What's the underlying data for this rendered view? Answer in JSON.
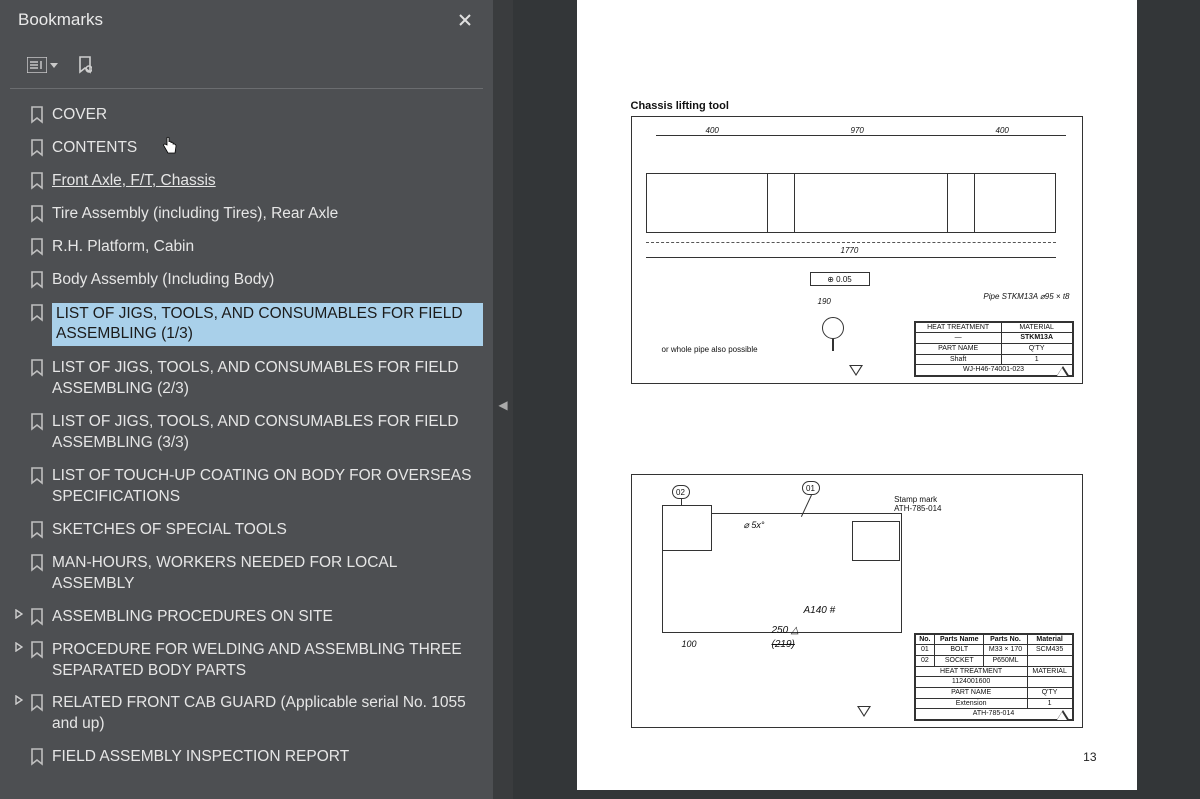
{
  "sidebar": {
    "title": "Bookmarks",
    "items": [
      {
        "label": "COVER",
        "selected": false,
        "expandable": false,
        "underlined": false
      },
      {
        "label": "CONTENTS",
        "selected": false,
        "expandable": false,
        "underlined": false
      },
      {
        "label": "Front Axle, F/T, Chassis",
        "selected": false,
        "expandable": false,
        "underlined": true
      },
      {
        "label": "Tire Assembly (including Tires), Rear Axle",
        "selected": false,
        "expandable": false,
        "underlined": false
      },
      {
        "label": "R.H. Platform, Cabin",
        "selected": false,
        "expandable": false,
        "underlined": false
      },
      {
        "label": "Body Assembly (Including Body)",
        "selected": false,
        "expandable": false,
        "underlined": false
      },
      {
        "label": "LIST OF JIGS, TOOLS, AND CONSUMABLES FOR FIELD ASSEMBLING (1/3)",
        "selected": true,
        "expandable": false,
        "underlined": false
      },
      {
        "label": "LIST OF JIGS, TOOLS, AND CONSUMABLES FOR FIELD ASSEMBLING (2/3)",
        "selected": false,
        "expandable": false,
        "underlined": false
      },
      {
        "label": "LIST OF JIGS, TOOLS, AND CONSUMABLES FOR FIELD ASSEMBLING (3/3)",
        "selected": false,
        "expandable": false,
        "underlined": false
      },
      {
        "label": "LIST OF TOUCH-UP COATING ON BODY FOR OVERSEAS SPECIFICATIONS",
        "selected": false,
        "expandable": false,
        "underlined": false
      },
      {
        "label": "SKETCHES OF SPECIAL TOOLS",
        "selected": false,
        "expandable": false,
        "underlined": false
      },
      {
        "label": "MAN-HOURS, WORKERS NEEDED FOR LOCAL ASSEMBLY",
        "selected": false,
        "expandable": false,
        "underlined": false
      },
      {
        "label": "ASSEMBLING PROCEDURES ON SITE",
        "selected": false,
        "expandable": true,
        "underlined": false
      },
      {
        "label": "PROCEDURE FOR WELDING AND ASSEMBLING THREE SEPARATED BODY PARTS",
        "selected": false,
        "expandable": true,
        "underlined": false
      },
      {
        "label": "RELATED FRONT CAB GUARD (Applicable serial No. 1055 and up)",
        "selected": false,
        "expandable": true,
        "underlined": false
      },
      {
        "label": "FIELD ASSEMBLY INSPECTION REPORT",
        "selected": false,
        "expandable": false,
        "underlined": false
      }
    ]
  },
  "page": {
    "number": "13",
    "drawing1": {
      "title": "Chassis lifting tool",
      "dims_top": [
        "400",
        "970",
        "400"
      ],
      "dim_bottom": "1770",
      "tolerance": "⊕ 0.05",
      "pipe_note": "Pipe  STKM13A  ⌀95 × t8",
      "sub_note": "or whole pipe also possible",
      "small_dim": "190",
      "titleblock": {
        "heat_label": "HEAT TREATMENT",
        "heat_val": "—",
        "mat_label": "MATERIAL",
        "mat_val": "STKM13A",
        "part_label": "PART NAME",
        "part_val": "Shaft",
        "qty_label": "Q'TY",
        "qty_val": "1",
        "dwg_no": "WJ-H46-74001-023"
      }
    },
    "drawing2": {
      "balloons": {
        "b1": "02",
        "b2": "01"
      },
      "stamp_label": "Stamp mark",
      "stamp_val": "ATH-785-014",
      "scribble": "⌀ 5x°",
      "dim100": "100",
      "hand1": "A140 #",
      "hand2": "250 △",
      "hand3": "(219)",
      "parts_header": {
        "no": "No.",
        "name": "Parts Name",
        "pno": "Parts No.",
        "mat": "Material"
      },
      "parts": [
        {
          "no": "01",
          "name": "BOLT",
          "pno": "M33 × 170",
          "mat": "SCM435"
        },
        {
          "no": "02",
          "name": "SOCKET",
          "pno": "P650ML",
          "mat": ""
        }
      ],
      "titleblock": {
        "heat_label": "HEAT TREATMENT",
        "heat_val": "1124001600",
        "mat_label": "MATERIAL",
        "mat_val": "",
        "part_label": "PART NAME",
        "part_val": "Extension",
        "qty_label": "Q'TY",
        "qty_val": "1",
        "dwg_no": "ATH-785-014"
      }
    }
  }
}
